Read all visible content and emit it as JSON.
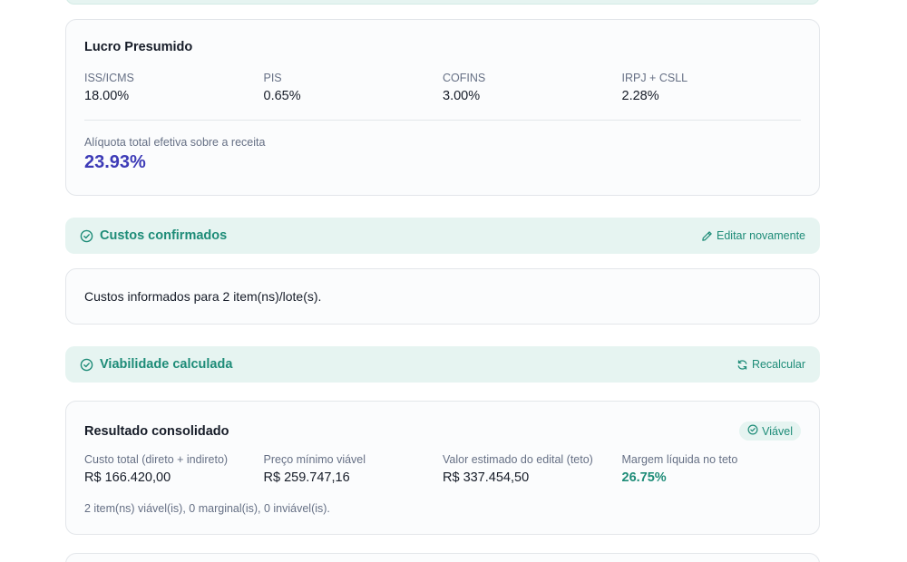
{
  "tax": {
    "title": "Lucro Presumido",
    "items": [
      {
        "label": "ISS/ICMS",
        "value": "18.00%"
      },
      {
        "label": "PIS",
        "value": "0.65%"
      },
      {
        "label": "COFINS",
        "value": "3.00%"
      },
      {
        "label": "IRPJ + CSLL",
        "value": "2.28%"
      }
    ],
    "total_label": "Alíquota total efetiva sobre a receita",
    "total_value": "23.93%"
  },
  "costs_banner": {
    "title": "Custos confirmados",
    "action": "Editar novamente",
    "icon": "check-circle-icon",
    "action_icon": "pencil-icon"
  },
  "costs_card": {
    "text": "Custos informados para 2 item(ns)/lote(s)."
  },
  "viability_banner": {
    "title": "Viabilidade calculada",
    "action": "Recalcular",
    "icon": "check-circle-icon",
    "action_icon": "refresh-icon"
  },
  "result": {
    "title": "Resultado consolidado",
    "badge": "Viável",
    "items": [
      {
        "label": "Custo total (direto + indireto)",
        "value": "R$ 166.420,00"
      },
      {
        "label": "Preço mínimo viável",
        "value": "R$ 259.747,16"
      },
      {
        "label": "Valor estimado do edital (teto)",
        "value": "R$ 337.454,50"
      },
      {
        "label": "Margem líquida no teto",
        "value": "26.75%"
      }
    ],
    "summary": "2 item(ns) viável(is), 0 marginal(is), 0 inviável(is)."
  },
  "colors": {
    "accent": "#1e8c78",
    "accent_bg": "#e6f4f1",
    "total_highlight": "#3d3bb7"
  }
}
